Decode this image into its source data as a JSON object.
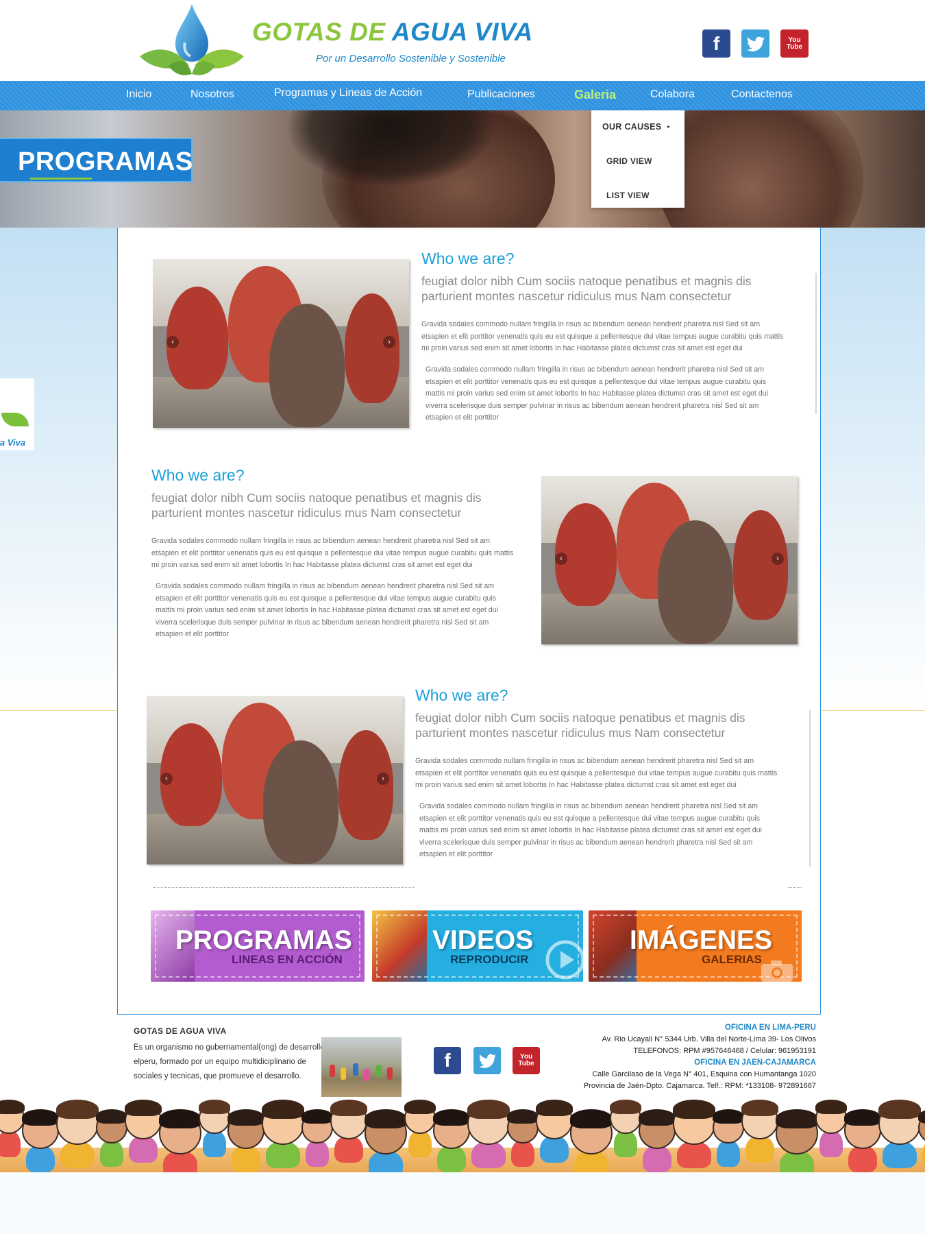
{
  "brand": {
    "name_part1": "GOTAS DE ",
    "name_part2": "AGUA VIVA",
    "tagline": "Por un Desarrollo Sostenible y Sostenible"
  },
  "social": {
    "facebook_icon": "f",
    "twitter_icon": "twitter-bird",
    "youtube_icon_line1": "You",
    "youtube_icon_line2": "Tube"
  },
  "nav": {
    "items": [
      "Inicio",
      "Nosotros",
      "Programas y Lineas de Acción",
      "Publicaciones",
      "Galeria",
      "Colabora",
      "Contactenos"
    ],
    "active": "Galeria"
  },
  "dropdown": {
    "items": [
      "OUR CAUSES",
      "GRID VIEW",
      "LIST VIEW"
    ],
    "caret": "▸"
  },
  "page_label": "PROGRAMAS",
  "side_logo_text": "ua Viva",
  "sections": [
    {
      "title": "Who we are?",
      "subtitle": "feugiat dolor nibh Cum sociis natoque penatibus et magnis dis parturient montes nascetur ridiculus mus Nam consectetur",
      "para1": "Gravida sodales commodo nullam fringilla in risus ac bibendum aenean hendrerit pharetra nisl Sed sit am etsapien et elit porttitor venenatis quis eu est quisque a pellentesque dui vitae tempus augue curabitu quis mattis mi proin varius sed enim sit amet lobortis In hac Habitasse platea dictumst cras sit amet est eget dui",
      "para2": "Gravida sodales commodo nullam fringilla in risus ac bibendum aenean hendrerit pharetra nisl Sed sit am etsapien et elit porttitor venenatis quis eu est quisque a pellentesque dui vitae tempus augue curabitu quis mattis mi proin varius sed enim sit amet lobortis In hac Habitasse platea dictumst cras sit amet est eget dui viverra scelerisque duis semper pulvinar in risus ac bibendum aenean hendrerit pharetra nisl Sed sit am etsapien et elit porttitor"
    },
    {
      "title": "Who we are?",
      "subtitle": "feugiat dolor nibh Cum sociis natoque penatibus et magnis dis parturient montes nascetur ridiculus mus Nam consectetur",
      "para1": "Gravida sodales commodo nullam fringilla in risus ac bibendum aenean hendrerit pharetra nisl Sed sit am etsapien et elit porttitor venenatis quis eu est quisque a pellentesque dui vitae tempus augue curabitu quis mattis mi proin varius sed enim sit amet lobortis In hac Habitasse platea dictumst cras sit amet est eget dui",
      "para2": "Gravida sodales commodo nullam fringilla in risus ac bibendum aenean hendrerit pharetra nisl Sed sit am etsapien et elit porttitor venenatis quis eu est quisque a pellentesque dui vitae tempus augue curabitu quis mattis mi proin varius sed enim sit amet lobortis In hac Habitasse platea dictumst cras sit amet est eget dui viverra scelerisque duis semper pulvinar in risus ac bibendum aenean hendrerit pharetra nisl Sed sit am etsapien et elit porttitor"
    },
    {
      "title": "Who we are?",
      "subtitle": "feugiat dolor nibh Cum sociis natoque penatibus et magnis dis parturient montes nascetur ridiculus mus Nam consectetur",
      "para1": "Gravida sodales commodo nullam fringilla in risus ac bibendum aenean hendrerit pharetra nisl Sed sit am etsapien et elit porttitor venenatis quis eu est quisque a pellentesque dui vitae tempus augue curabitu quis mattis mi proin varius sed enim sit amet lobortis In hac Habitasse platea dictumst cras sit amet est eget dui",
      "para2": "Gravida sodales commodo nullam fringilla in risus ac bibendum aenean hendrerit pharetra nisl Sed sit am etsapien et elit porttitor venenatis quis eu est quisque a pellentesque dui vitae tempus augue curabitu quis mattis mi proin varius sed enim sit amet lobortis In hac Habitasse platea dictumst cras sit amet est eget dui viverra scelerisque duis semper pulvinar in risus ac bibendum aenean hendrerit pharetra nisl Sed sit am etsapien et elit porttitor"
    }
  ],
  "slider": {
    "prev_icon": "‹",
    "next_icon": "›"
  },
  "promos": [
    {
      "big": "PROGRAMAS",
      "small": "LINEAS EN ACCIÓN",
      "color": "#b25ccf",
      "small_color": "#5a1a73"
    },
    {
      "big": "VIDEOS",
      "small": "REPRODUCIR",
      "color": "#25aee0",
      "small_color": "#0b3d5c"
    },
    {
      "big": "IMÁGENES",
      "small": "GALERIAS",
      "color": "#f37a1f",
      "small_color": "#6b2a00"
    }
  ],
  "footer": {
    "title": "GOTAS DE AGUA VIVA",
    "desc_line1": "Es un organismo no gubernamental(ong) de desarrollo",
    "desc_line2": "elperu, formado por un equipo multidiciplinario de",
    "desc_line3": "sociales y tecnicas, que promueve el desarrollo.",
    "office1_title": "OFICINA EN LIMA-PERU",
    "office1_line1": "Av. Rio Ucayali N° 5344 Urb. Villa del Norte-Lima 39- Los Olivos",
    "office1_line2": "TELEFONOS: RPM #957646468 / Celular: 961953191",
    "office2_title": "OFICINA EN JAEN-CAJAMARCA",
    "office2_line1": "Calle Garcilaso de la Vega N° 401, Esquina con Humantanga 1020",
    "office2_line2": "Provincia de Jaén-Dpto. Cajamarca. Telf.: RPM: *133108- 972891667"
  },
  "colors": {
    "nav_blue": "#2e92e0",
    "brand_green": "#8cc63f",
    "brand_blue": "#1e88c9",
    "heading_blue": "#1aa0d8"
  }
}
